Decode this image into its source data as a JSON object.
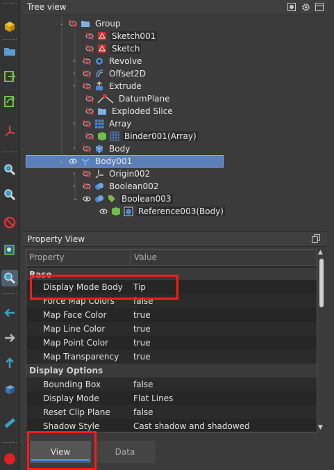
{
  "tree_view": {
    "title": "Tree view",
    "items": [
      {
        "label": "Group"
      },
      {
        "label": "Sketch001"
      },
      {
        "label": "Sketch"
      },
      {
        "label": "Revolve"
      },
      {
        "label": "Offset2D"
      },
      {
        "label": "Extrude"
      },
      {
        "label": "DatumPlane"
      },
      {
        "label": "Exploded Slice"
      },
      {
        "label": "Array"
      },
      {
        "label": "Binder001(Array)"
      },
      {
        "label": "Body"
      },
      {
        "label": "Body001"
      },
      {
        "label": "Origin002"
      },
      {
        "label": "Boolean002"
      },
      {
        "label": "Boolean003"
      },
      {
        "label": "Reference003(Body)"
      }
    ]
  },
  "property_view": {
    "title": "Property View",
    "col_property": "Property",
    "col_value": "Value",
    "group_base": "Base",
    "group_display": "Display Options",
    "rows_base": [
      {
        "name": "Display Mode Body",
        "value": "Tip"
      },
      {
        "name": "Force Map Colors",
        "value": "false"
      },
      {
        "name": "Map Face Color",
        "value": "true"
      },
      {
        "name": "Map Line Color",
        "value": "true"
      },
      {
        "name": "Map Point Color",
        "value": "true"
      },
      {
        "name": "Map Transparency",
        "value": "true"
      }
    ],
    "rows_display": [
      {
        "name": "Bounding Box",
        "value": "false"
      },
      {
        "name": "Display Mode",
        "value": "Flat Lines"
      },
      {
        "name": "Reset Clip Plane",
        "value": "false"
      },
      {
        "name": "Shadow Style",
        "value": "Cast shadow and shadowed"
      }
    ]
  },
  "tabs": {
    "view": "View",
    "data": "Data"
  },
  "colors": {
    "selection": "#5b7fb8",
    "highlight": "#ff1a1a",
    "tab_underline": "#4a8ad8"
  }
}
